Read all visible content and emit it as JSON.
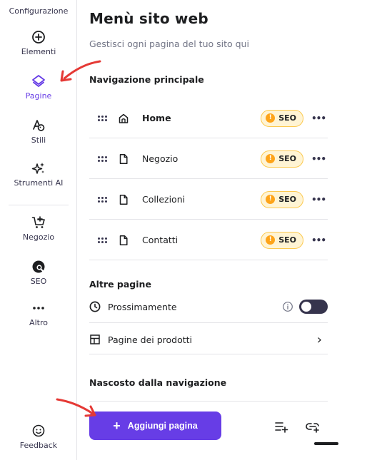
{
  "sidebar": {
    "top_label": "Configurazione",
    "items": [
      {
        "label": "Elementi",
        "icon": "plus-circle-icon"
      },
      {
        "label": "Pagine",
        "icon": "layers-icon",
        "active": true
      },
      {
        "label": "Stili",
        "icon": "styles-icon"
      },
      {
        "label": "Strumenti AI",
        "icon": "ai-sparkle-icon"
      },
      {
        "label": "Negozio",
        "icon": "cart-icon"
      },
      {
        "label": "SEO",
        "icon": "seo-icon"
      },
      {
        "label": "Altro",
        "icon": "more-icon"
      }
    ],
    "feedback_label": "Feedback"
  },
  "main": {
    "title": "Menù sito web",
    "subtitle": "Gestisci ogni pagina del tuo sito qui",
    "nav_section_title": "Navigazione principale",
    "nav_pages": [
      {
        "label": "Home",
        "icon": "home-icon",
        "badge": "SEO"
      },
      {
        "label": "Negozio",
        "icon": "page-icon",
        "badge": "SEO"
      },
      {
        "label": "Collezioni",
        "icon": "page-icon",
        "badge": "SEO"
      },
      {
        "label": "Contatti",
        "icon": "page-icon",
        "badge": "SEO"
      }
    ],
    "more_glyph": "•••",
    "badge_glyph": "!",
    "other_section_title": "Altre pagine",
    "coming_soon_label": "Prossimamente",
    "coming_soon_enabled": false,
    "product_pages_label": "Pagine dei prodotti",
    "chevron_glyph": "›",
    "hidden_section_title": "Nascosto dalla navigazione",
    "add_button_plus": "+",
    "add_button_label": "Aggiungi pagina"
  },
  "colors": {
    "accent": "#673de6",
    "seo_badge_bg": "#fff4d4",
    "seo_badge_border": "#fcc94f",
    "seo_dot": "#fea419",
    "annotation_arrow": "#e53935"
  }
}
